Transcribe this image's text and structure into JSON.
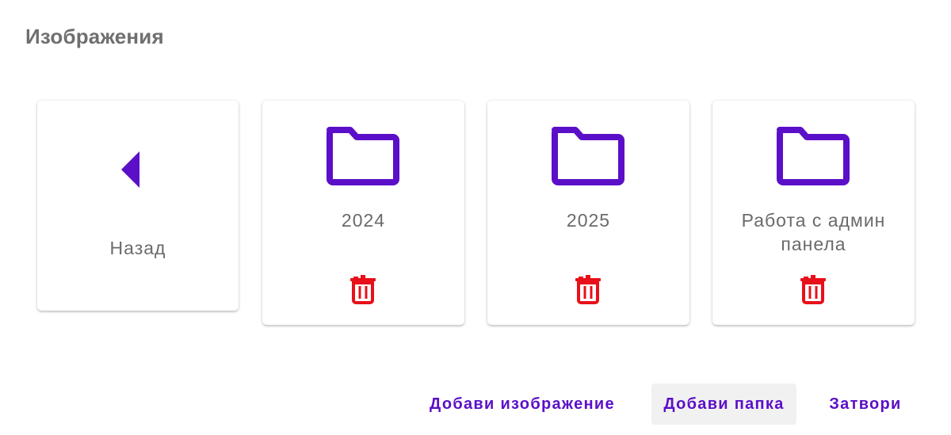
{
  "dialog": {
    "title": "Изображения"
  },
  "back_card": {
    "label": "Назад",
    "icon": "arrow-left-icon"
  },
  "folders": [
    {
      "label": "2024",
      "icon": "folder-icon",
      "delete_icon": "trash-icon"
    },
    {
      "label": "2025",
      "icon": "folder-icon",
      "delete_icon": "trash-icon"
    },
    {
      "label": "Работа с админ панела",
      "icon": "folder-icon",
      "delete_icon": "trash-icon"
    }
  ],
  "actions": {
    "add_image": "Добави изображение",
    "add_folder": "Добави папка",
    "close": "Затвори"
  },
  "colors": {
    "accent": "#5b0fc8",
    "delete": "#e8101a",
    "text": "#6a6a6a",
    "title": "#6f6f6f"
  }
}
